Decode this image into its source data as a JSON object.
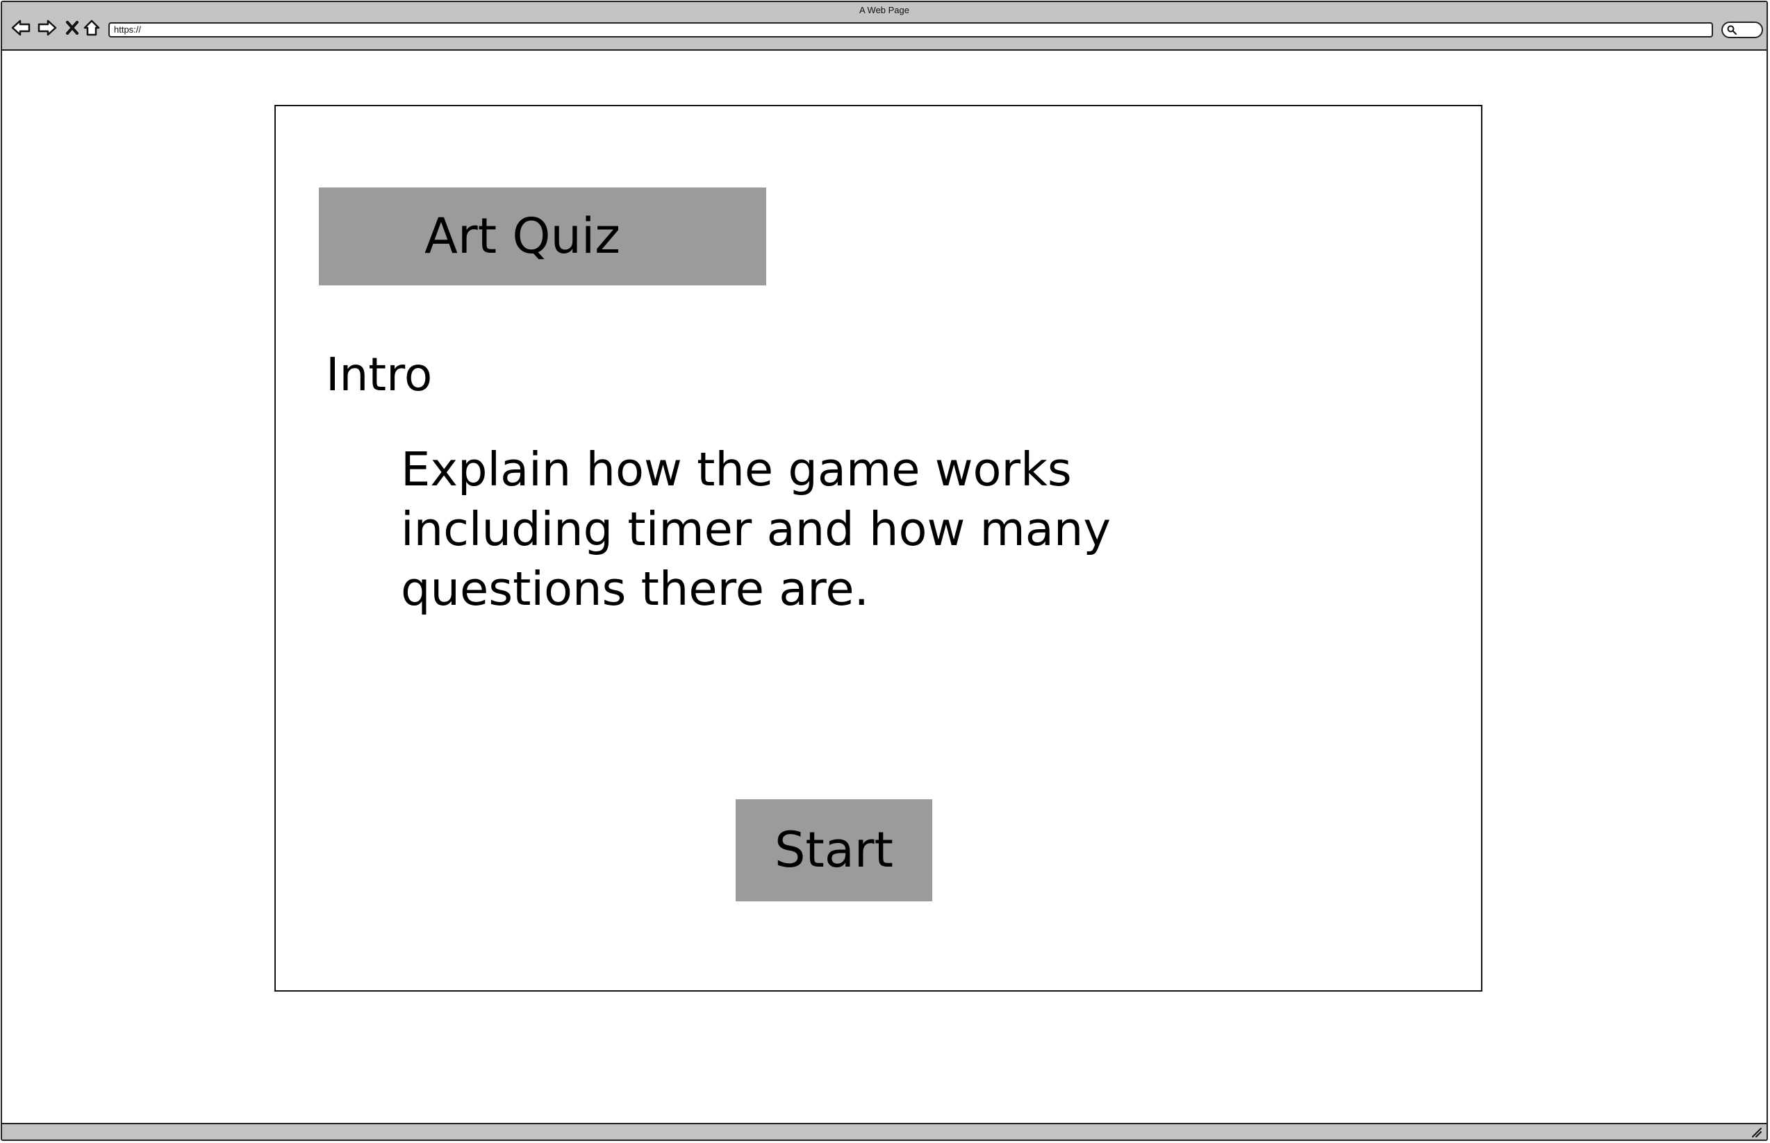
{
  "browser": {
    "window_title": "A Web Page",
    "url": "https://",
    "icons": {
      "back": "back-arrow-icon",
      "forward": "forward-arrow-icon",
      "stop": "close-icon",
      "home": "home-icon",
      "search": "search-icon",
      "resize": "resize-grip-icon"
    }
  },
  "quiz": {
    "title": "Art Quiz",
    "intro_heading": "Intro",
    "intro_text": "Explain how the game works including timer and how many questions there are.",
    "start_label": "Start"
  },
  "colors": {
    "chrome_gray": "#c4c4c4",
    "block_gray": "#9b9b9b",
    "ink": "#000000"
  }
}
